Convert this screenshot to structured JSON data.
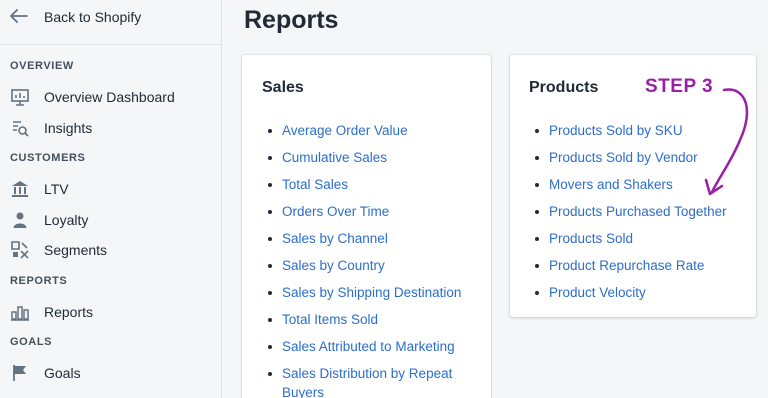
{
  "sidebar": {
    "back_label": "Back to Shopify",
    "sections": {
      "overview": "OVERVIEW",
      "customers": "CUSTOMERS",
      "reports": "REPORTS",
      "goals": "GOALS"
    },
    "items": {
      "overview_dashboard": "Overview Dashboard",
      "insights": "Insights",
      "ltv": "LTV",
      "loyalty": "Loyalty",
      "segments": "Segments",
      "reports": "Reports",
      "goals": "Goals"
    },
    "icons": [
      "arrow-left-icon",
      "dashboard-icon",
      "insights-icon",
      "bank-icon",
      "person-icon",
      "segments-icon",
      "bar-chart-icon",
      "flag-icon"
    ]
  },
  "main": {
    "title": "Reports",
    "sales": {
      "title": "Sales",
      "links": [
        "Average Order Value",
        "Cumulative Sales",
        "Total Sales",
        "Orders Over Time",
        "Sales by Channel",
        "Sales by Country",
        "Sales by Shipping Destination",
        "Total Items Sold",
        "Sales Attributed to Marketing",
        "Sales Distribution by Repeat Buyers"
      ]
    },
    "products": {
      "title": "Products",
      "links": [
        "Products Sold by SKU",
        "Products Sold by Vendor",
        "Movers and Shakers",
        "Products Purchased Together",
        "Products Sold",
        "Product Repurchase Rate",
        "Product Velocity"
      ]
    },
    "annotation": "STEP 3"
  },
  "colors": {
    "link": "#2c6ecb",
    "annotation": "#9b1ea6",
    "background": "#f4f6f8"
  }
}
